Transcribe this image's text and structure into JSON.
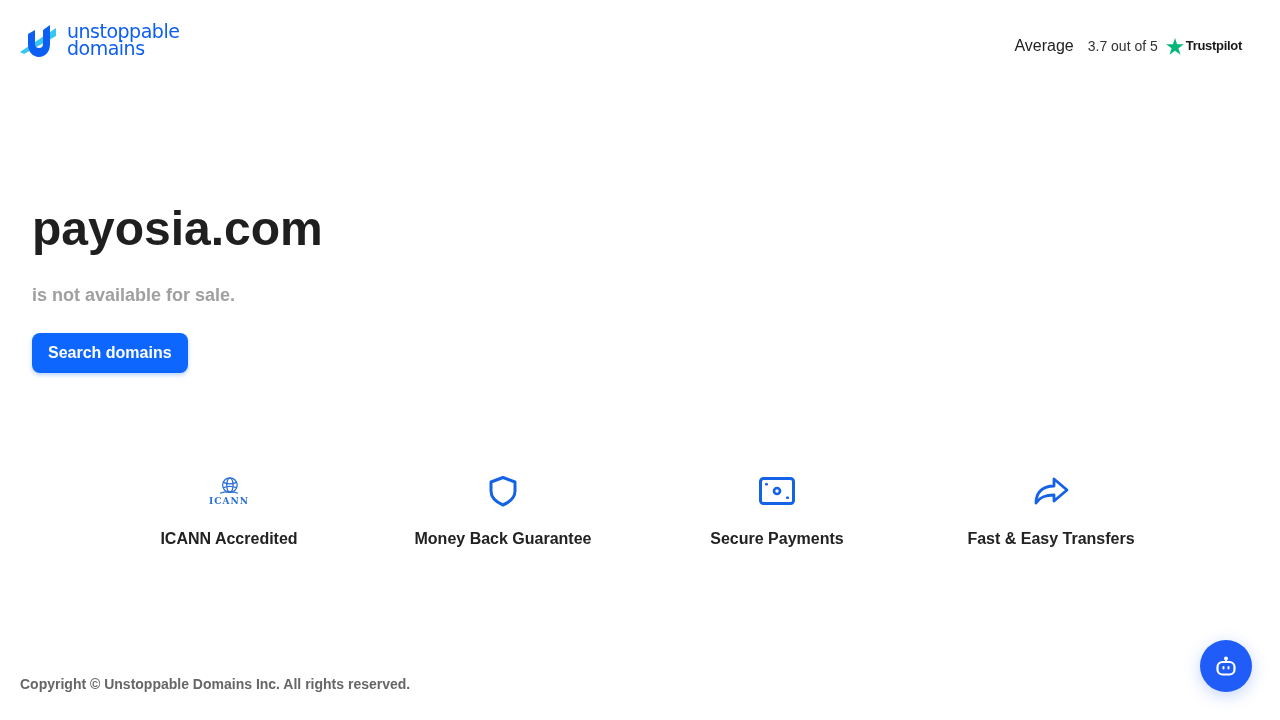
{
  "header": {
    "logo": {
      "line_1": "unstoppable",
      "line_2": "domains"
    },
    "rating": {
      "label": "Average",
      "score": "3.7 out of 5",
      "brand": "Trustpilot"
    }
  },
  "hero": {
    "domain": "payosia.com",
    "status": "is not available for sale.",
    "button": "Search domains"
  },
  "features": [
    {
      "kind": "icann",
      "icon_text": "ICANN",
      "label": "ICANN Accredited"
    },
    {
      "kind": "shield",
      "label": "Money Back Guarantee"
    },
    {
      "kind": "payment",
      "label": "Secure Payments"
    },
    {
      "kind": "transfer",
      "label": "Fast & Easy Transfers"
    }
  ],
  "footer": {
    "copyright": "Copyright © Unstoppable Domains Inc. All rights reserved."
  }
}
